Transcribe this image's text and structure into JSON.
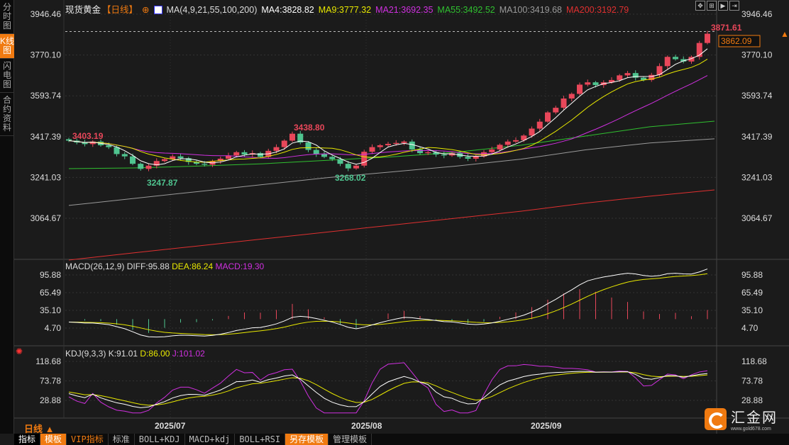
{
  "side_tabs": [
    "分时图",
    "K线图",
    "闪电图",
    "合约资料"
  ],
  "header": {
    "instrument": "现货黄金",
    "period": "【日线】",
    "ma_title": "MA(4,9,21,55,100,200)",
    "ma4": "MA4:3828.82",
    "ma9": "MA9:3777.32",
    "ma21": "MA21:3692.35",
    "ma55": "MA55:3492.52",
    "ma100": "MA100:3419.68",
    "ma200": "MA200:3192.79"
  },
  "macd_header": {
    "title": "MACD(26,12,9)",
    "diff": "DIFF:95.88",
    "dea": "DEA:86.24",
    "macd": "MACD:19.30"
  },
  "kdj_header": {
    "title": "KDJ(9,3,3)",
    "k": "K:91.01",
    "d": "D:86.00",
    "j": "J:101.02"
  },
  "price_axis": [
    "3946.46",
    "3770.10",
    "3593.74",
    "3417.39",
    "3241.03",
    "3064.67"
  ],
  "macd_axis": [
    "95.88",
    "65.49",
    "35.10",
    "4.70"
  ],
  "kdj_axis": [
    "118.68",
    "73.78",
    "28.88"
  ],
  "current_price": "3862.09",
  "annotations": {
    "high_last": "3871.61",
    "high1": "3403.19",
    "low1": "3247.87",
    "high2": "3438.80",
    "low2": "3268.02"
  },
  "dates": [
    "2025/07",
    "2025/08",
    "2025/09"
  ],
  "period_selector": "日线 ▲",
  "bottom_tabs": [
    "指标",
    "模板",
    "VIP指标",
    "标准",
    "BOLL+KDJ",
    "MACD+kdj",
    "BOLL+RSI",
    "另存模板",
    "管理模板"
  ],
  "logo": {
    "name": "汇金网",
    "url": "www.gold678.com"
  },
  "colors": {
    "up": "#e8475a",
    "down": "#4fc48f",
    "ma4": "#ffffff",
    "ma9": "#e8e800",
    "ma21": "#d030e0",
    "ma55": "#30c030",
    "ma100": "#9a9a9a",
    "ma200": "#e03030",
    "accent": "#f07a10"
  },
  "chart_data": {
    "type": "candlestick",
    "title": "现货黄金 日线",
    "ylim": [
      3064.67,
      3946.46
    ],
    "close": [
      3400,
      3392,
      3385,
      3396,
      3380,
      3372,
      3342,
      3332,
      3300,
      3278,
      3292,
      3312,
      3320,
      3332,
      3324,
      3308,
      3300,
      3296,
      3312,
      3322,
      3336,
      3350,
      3340,
      3346,
      3330,
      3356,
      3372,
      3400,
      3430,
      3392,
      3360,
      3342,
      3330,
      3320,
      3300,
      3280,
      3292,
      3352,
      3372,
      3380,
      3386,
      3390,
      3396,
      3362,
      3346,
      3350,
      3340,
      3336,
      3346,
      3330,
      3322,
      3332,
      3350,
      3362,
      3382,
      3396,
      3402,
      3422,
      3452,
      3482,
      3522,
      3542,
      3582,
      3602,
      3642,
      3652,
      3640,
      3652,
      3662,
      3682,
      3692,
      3672,
      3662,
      3684,
      3722,
      3762,
      3752,
      3742,
      3762,
      3822,
      3862
    ],
    "ma55": [
      3279,
      3282,
      3290,
      3300,
      3315,
      3330,
      3350,
      3380,
      3420,
      3460,
      3484
    ],
    "ma100": [
      3120,
      3150,
      3180,
      3210,
      3240,
      3265,
      3290,
      3320,
      3360,
      3390,
      3408
    ],
    "ma200": [
      2884,
      2915,
      2945,
      2975,
      3005,
      3035,
      3065,
      3095,
      3130,
      3160,
      3187
    ],
    "macd_ylim": [
      4.7,
      95.88
    ],
    "kdj_ylim": [
      28.88,
      118.68
    ]
  }
}
